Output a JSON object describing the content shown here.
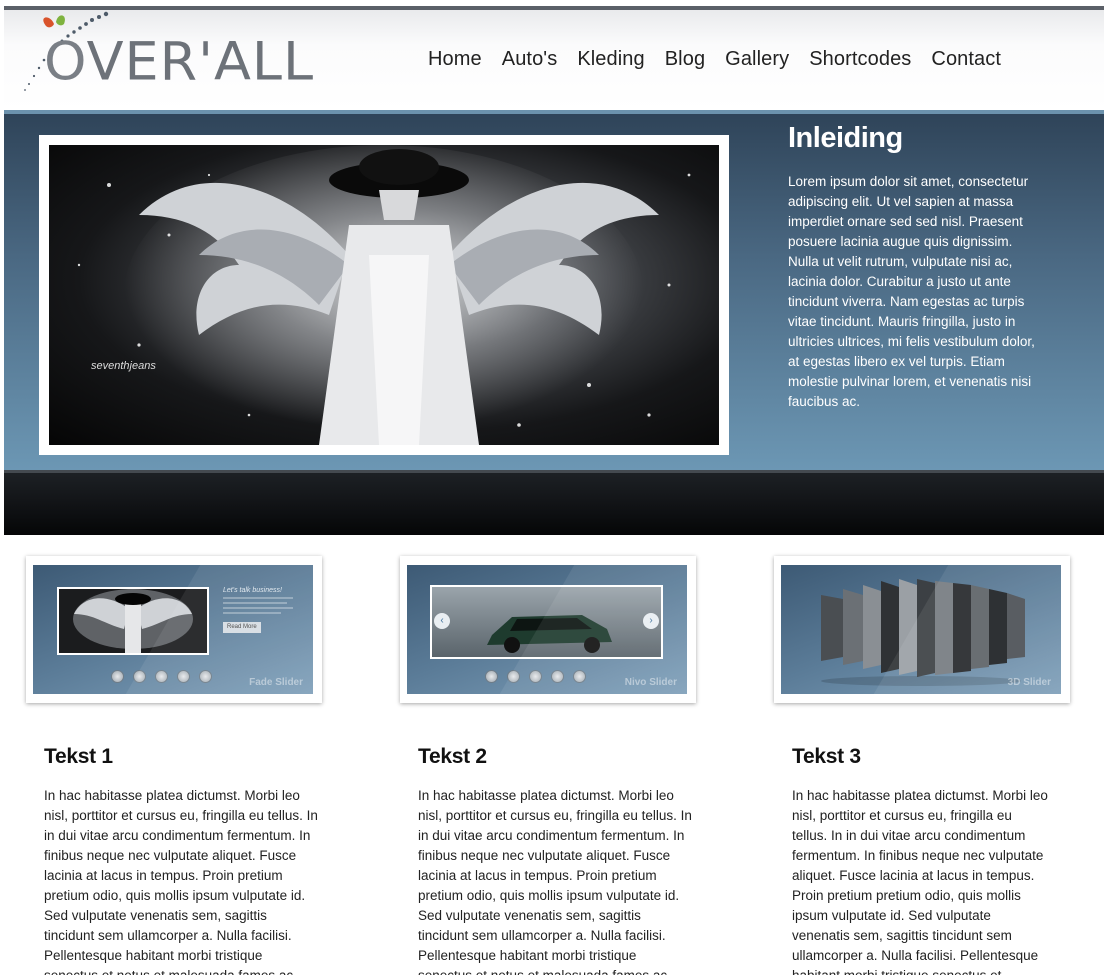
{
  "brand": {
    "logo_text": "VER'ALL",
    "logo_o": "O"
  },
  "nav": [
    "Home",
    "Auto's",
    "Kleding",
    "Blog",
    "Gallery",
    "Shortcodes",
    "Contact"
  ],
  "hero": {
    "title": "Inleiding",
    "text": "Lorem ipsum dolor sit amet, consectetur adipiscing elit. Ut vel sapien at massa imperdiet ornare sed sed nisl. Praesent posuere lacinia augue quis dignissim. Nulla ut velit rutrum, vulputate nisi ac, lacinia dolor. Curabitur a justo ut ante tincidunt viverra. Nam egestas ac turpis vitae tincidunt. Mauris fringilla, justo in ultricies ultrices, mi felis vestibulum dolor, at egestas libero ex vel turpis. Etiam molestie pulvinar lorem, et venenatis nisi faucibus ac.",
    "image_brand": "seventhjeans"
  },
  "sliders": [
    {
      "label": "Fade Slider",
      "caption": "Let's talk business!",
      "button": "Read More"
    },
    {
      "label": "Nivo Slider"
    },
    {
      "label": "3D Slider"
    }
  ],
  "columns": [
    {
      "title": "Tekst 1",
      "text": "In hac habitasse platea dictumst. Morbi leo nisl, porttitor et cursus eu, fringilla eu tellus. In in dui vitae arcu condimentum fermentum. In finibus neque nec vulputate aliquet. Fusce lacinia at lacus in tempus. Proin pretium pretium odio, quis mollis ipsum vulputate id. Sed vulputate venenatis sem, sagittis tincidunt sem ullamcorper a. Nulla facilisi. Pellentesque habitant morbi tristique senectus et netus et malesuada fames ac"
    },
    {
      "title": "Tekst 2",
      "text": "In hac habitasse platea dictumst. Morbi leo nisl, porttitor et cursus eu, fringilla eu tellus. In in dui vitae arcu condimentum fermentum. In finibus neque nec vulputate aliquet. Fusce lacinia at lacus in tempus. Proin pretium pretium odio, quis mollis ipsum vulputate id. Sed vulputate venenatis sem, sagittis tincidunt sem ullamcorper a. Nulla facilisi. Pellentesque habitant morbi tristique senectus et netus et malesuada fames ac"
    },
    {
      "title": "Tekst 3",
      "text": "In hac habitasse platea dictumst. Morbi leo nisl, porttitor et cursus eu, fringilla eu tellus. In in dui vitae arcu condimentum fermentum. In finibus neque nec vulputate aliquet. Fusce lacinia at lacus in tempus. Proin pretium pretium odio, quis mollis ipsum vulputate id. Sed vulputate venenatis sem, sagittis tincidunt sem ullamcorper a. Nulla facilisi. Pellentesque habitant morbi tristique senectus et"
    }
  ],
  "colors": {
    "hero_top": "#2f4459",
    "hero_bottom": "#6c97b4",
    "accent": "#4f7ea0",
    "logo_leaf_red": "#d9532b",
    "logo_leaf_green": "#7fb33f"
  }
}
